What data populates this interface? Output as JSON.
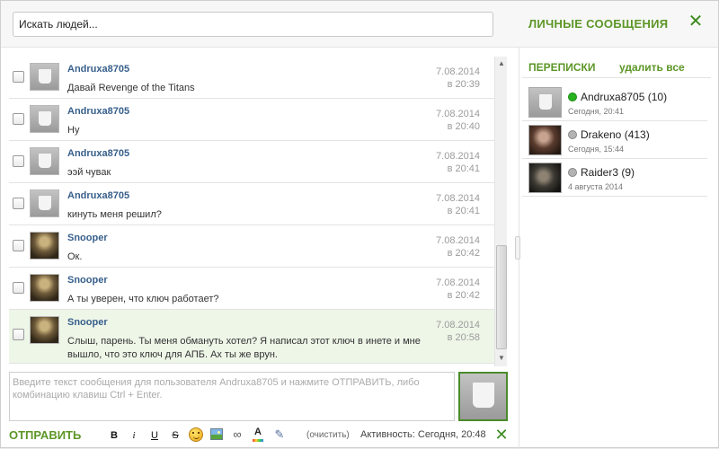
{
  "header": {
    "search_placeholder": "Искать людей...",
    "title": "ЛИЧНЫЕ СООБЩЕНИЯ",
    "close_icon": "close-icon"
  },
  "messages": [
    {
      "sender": "Andruxa8705",
      "text": "Давай Revenge of the Titans",
      "date": "7.08.2014",
      "time": "в 20:39",
      "avatar": "placeholder"
    },
    {
      "sender": "Andruxa8705",
      "text": "Ну",
      "date": "7.08.2014",
      "time": "в 20:40",
      "avatar": "placeholder"
    },
    {
      "sender": "Andruxa8705",
      "text": "ээй чувак",
      "date": "7.08.2014",
      "time": "в 20:41",
      "avatar": "placeholder"
    },
    {
      "sender": "Andruxa8705",
      "text": "кинуть меня решил?",
      "date": "7.08.2014",
      "time": "в 20:41",
      "avatar": "placeholder"
    },
    {
      "sender": "Snooper",
      "text": "Ок.",
      "date": "7.08.2014",
      "time": "в 20:42",
      "avatar": "photo"
    },
    {
      "sender": "Snooper",
      "text": "А ты уверен, что ключ работает?",
      "date": "7.08.2014",
      "time": "в 20:42",
      "avatar": "photo"
    },
    {
      "sender": "Snooper",
      "text": "Слыш, парень. Ты меня обмануть хотел? Я написал этот ключ в инете и мне вышло, что это ключ для АПБ. Ах ты же врун.",
      "date": "7.08.2014",
      "time": "в 20:58",
      "avatar": "photo"
    }
  ],
  "compose": {
    "placeholder": "Введите текст сообщения для пользователя Andruxa8705 и нажмите ОТПРАВИТЬ, либо комбинацию клавиш Ctrl + Enter."
  },
  "toolbar": {
    "send_label": "ОТПРАВИТЬ",
    "bold": "B",
    "italic": "i",
    "underline": "U",
    "strike": "S",
    "color_glyph": "A",
    "clear_label": "(очистить)",
    "activity": "Активность: Сегодня, 20:48"
  },
  "sidebar": {
    "title": "ПЕРЕПИСКИ",
    "delete_all": "удалить все",
    "conversations": [
      {
        "name": "Andruxa8705 (10)",
        "date": "Сегодня, 20:41",
        "status": "online"
      },
      {
        "name": "Drakeno (413)",
        "date": "Сегодня, 15:44",
        "status": "offline"
      },
      {
        "name": "Raider3 (9)",
        "date": "4 августа 2014",
        "status": "offline"
      }
    ]
  },
  "colors": {
    "accent": "#5c9626",
    "sender": "#375f8b",
    "online": "#27b21f"
  }
}
